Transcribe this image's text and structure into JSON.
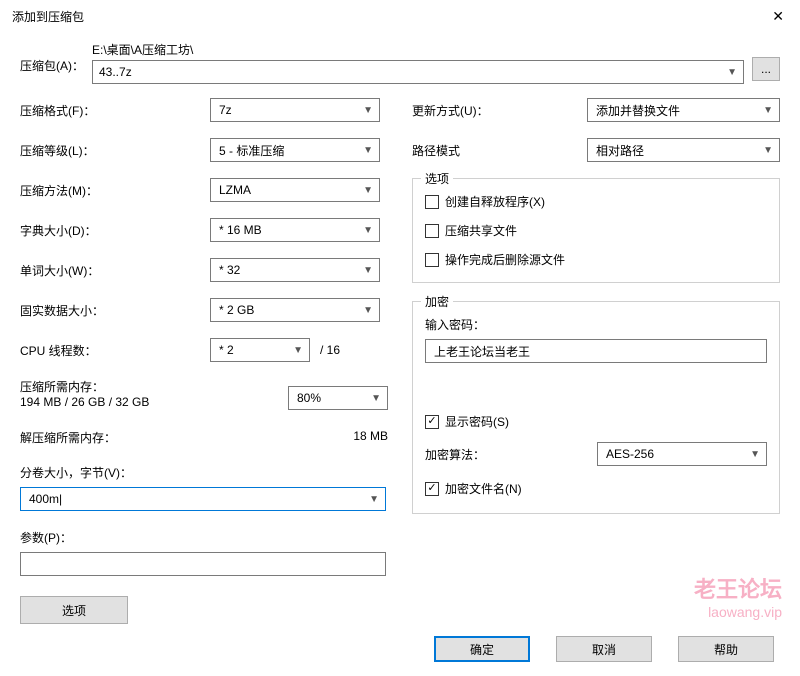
{
  "title": "添加到压缩包",
  "archive": {
    "label": "压缩包(A)：",
    "path": "E:\\桌面\\A压缩工坊\\",
    "filename": "43..7z",
    "browse": "..."
  },
  "left": {
    "format": {
      "label": "压缩格式(F)：",
      "value": "7z"
    },
    "level": {
      "label": "压缩等级(L)：",
      "value": "5 - 标准压缩"
    },
    "method": {
      "label": "压缩方法(M)：",
      "value": "LZMA"
    },
    "dict": {
      "label": "字典大小(D)：",
      "value": "* 16 MB"
    },
    "word": {
      "label": "单词大小(W)：",
      "value": "* 32"
    },
    "solid": {
      "label": "固实数据大小：",
      "value": "* 2 GB"
    },
    "threads": {
      "label": "CPU 线程数：",
      "value": "* 2",
      "suffix": "/ 16"
    },
    "mem_compress_label": "压缩所需内存：",
    "mem_compress_value": "194 MB / 26 GB / 32 GB",
    "mem_percent": "80%",
    "mem_decompress_label": "解压缩所需内存：",
    "mem_decompress_value": "18 MB",
    "split_label": "分卷大小，字节(V)：",
    "split_value": "400m|",
    "param_label": "参数(P)：",
    "options_btn": "选项"
  },
  "right": {
    "update": {
      "label": "更新方式(U)：",
      "value": "添加并替换文件"
    },
    "pathmode": {
      "label": "路径模式",
      "value": "相对路径"
    },
    "options_group": {
      "title": "选项",
      "sfx": "创建自释放程序(X)",
      "shared": "压缩共享文件",
      "delete_after": "操作完成后删除源文件"
    },
    "encrypt_group": {
      "title": "加密",
      "password_label": "输入密码：",
      "password_value": "上老王论坛当老王",
      "show_password": "显示密码(S)",
      "algo_label": "加密算法：",
      "algo_value": "AES-256",
      "encrypt_names": "加密文件名(N)"
    }
  },
  "watermark": {
    "line1": "老王论坛",
    "line2": "laowang.vip"
  },
  "footer": {
    "ok": "确定",
    "cancel": "取消",
    "help": "帮助"
  }
}
